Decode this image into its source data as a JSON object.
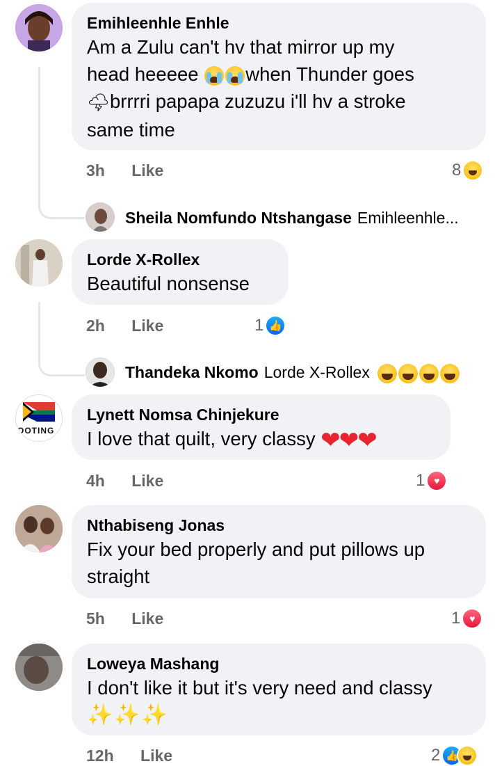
{
  "comments": [
    {
      "author": "Emihleenhle Enhle",
      "lines": [
        "Am a Zulu can't hv that mirror up my",
        "head heeeee",
        "when Thunder goes",
        "brrrri papapa zuzuzu i'll hv a stroke",
        "same time"
      ],
      "time": "3h",
      "like_label": "Like",
      "reaction_count": "8",
      "reaction_icons": [
        "haha-icon"
      ],
      "avatar_color": "#b59ad9"
    },
    {
      "author": "Lorde X-Rollex",
      "lines": [
        "Beautiful nonsense"
      ],
      "time": "2h",
      "like_label": "Like",
      "reaction_count": "1",
      "reaction_icons": [
        "like-icon"
      ],
      "avatar_color": "#c9b8a2"
    },
    {
      "author": "Lynett Nomsa Chinjekure",
      "lines": [
        "I love that quilt, very classy"
      ],
      "time": "4h",
      "like_label": "Like",
      "reaction_count": "1",
      "reaction_icons": [
        "love-icon"
      ],
      "avatar_text": "OOTING"
    },
    {
      "author": "Nthabiseng Jonas",
      "lines": [
        "Fix your bed properly and put pillows up",
        "straight"
      ],
      "time": "5h",
      "like_label": "Like",
      "reaction_count": "1",
      "reaction_icons": [
        "love-icon"
      ],
      "avatar_color": "#8b6f5c"
    },
    {
      "author": "Loweya Mashang",
      "lines": [
        "I don't like it but it's very need and classy"
      ],
      "time": "12h",
      "like_label": "Like",
      "reaction_count": "2",
      "reaction_icons": [
        "like-icon",
        "haha-icon"
      ],
      "avatar_color": "#7d7570"
    }
  ],
  "replies": [
    {
      "name": "Sheila Nomfundo Ntshangase",
      "preview": "Emihleenhle...",
      "avatar_color": "#a89a95"
    },
    {
      "name": "Thandeka Nkomo",
      "preview": "Lorde X-Rollex",
      "avatar_color": "#54504f"
    }
  ],
  "colors": {
    "bubble": "#f0f2f5",
    "meta_text": "#65676b",
    "like_blue": "#0a7cff",
    "love_red": "#e61739"
  }
}
